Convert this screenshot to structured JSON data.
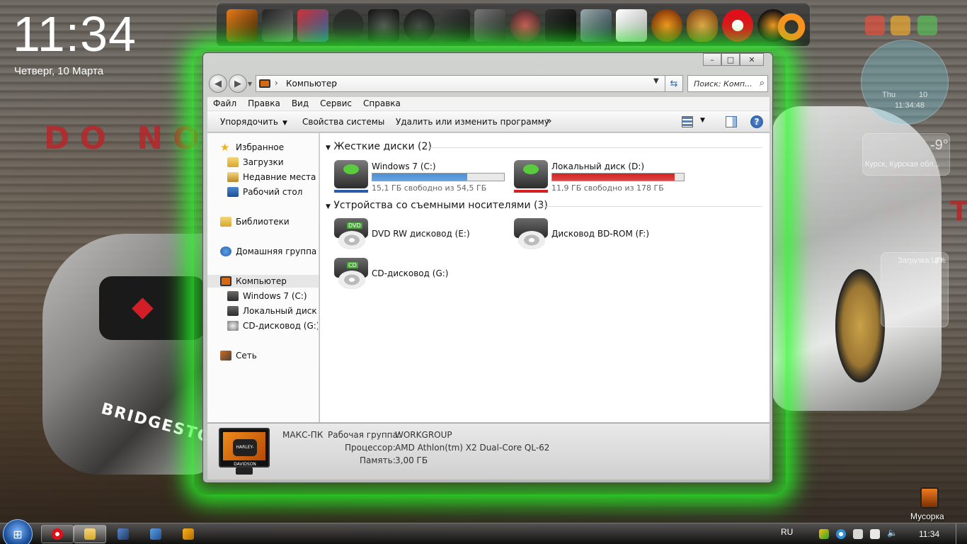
{
  "desktop": {
    "clock_time": "11:34",
    "clock_date": "Четверг, 10 Марта",
    "wall_text_left": "DO NOT B",
    "wall_text_right": "DO NOT",
    "gadget_calendar_day": "Thu",
    "gadget_calendar_num": "10",
    "gadget_clock_time": "11:34:48",
    "gadget_weather_temp": "-9°",
    "gadget_weather_city": "Курск, Курская обл...",
    "gadget_cpu_label": "Загрузка ЦП",
    "gadget_cpu_value": "4%",
    "recycle_bin_label": "Мусорка"
  },
  "window": {
    "address": {
      "segment": "Компьютер"
    },
    "search_placeholder": "Поиск: Комп...",
    "menu": [
      "Файл",
      "Правка",
      "Вид",
      "Сервис",
      "Справка"
    ],
    "commands": {
      "organize": "Упорядочить",
      "system_properties": "Свойства системы",
      "uninstall": "Удалить или изменить программу",
      "more": "»"
    },
    "nav": {
      "favorites": "Избранное",
      "downloads": "Загрузки",
      "recent": "Недавние места",
      "desktop": "Рабочий стол",
      "libraries": "Библиотеки",
      "homegroup": "Домашняя группа",
      "computer": "Компьютер",
      "drive_c": "Windows 7 (C:)",
      "drive_d": "Локальный диск (D:)",
      "drive_g": "CD-дисковод (G:)",
      "network": "Сеть"
    },
    "groups": {
      "hard_disks": "Жесткие диски (2)",
      "removable": "Устройства со съемными носителями (3)"
    },
    "drives": [
      {
        "name": "Windows 7 (C:)",
        "free": "15,1 ГБ свободно из 54,5 ГБ",
        "used_fraction": 0.72,
        "bar_color": "#4a90d9"
      },
      {
        "name": "Локальный диск (D:)",
        "free": "11,9 ГБ свободно из 178 ГБ",
        "used_fraction": 0.93,
        "bar_color": "#d62020"
      }
    ],
    "removable": [
      {
        "name": "DVD RW дисковод (E:)",
        "tag": "DVD"
      },
      {
        "name": "Дисковод BD-ROM (F:)",
        "tag": ""
      },
      {
        "name": "CD-дисковод (G:)",
        "tag": "CD"
      }
    ],
    "details": {
      "computer_name": "МАКС-ПК",
      "workgroup_label": "Рабочая группа:",
      "workgroup_value": "WORKGROUP",
      "cpu_label": "Процессор:",
      "cpu_value": "AMD Athlon(tm) X2 Dual-Core QL-62",
      "ram_label": "Память:",
      "ram_value": "3,00 ГБ",
      "monitor_logo": "HARLEY-DAVIDSON"
    }
  },
  "taskbar": {
    "lang": "RU",
    "time": "11:34"
  },
  "colors": {
    "glow": "#28ff28",
    "drive_c_bar": "#4a90d9",
    "drive_d_bar": "#d62020"
  }
}
